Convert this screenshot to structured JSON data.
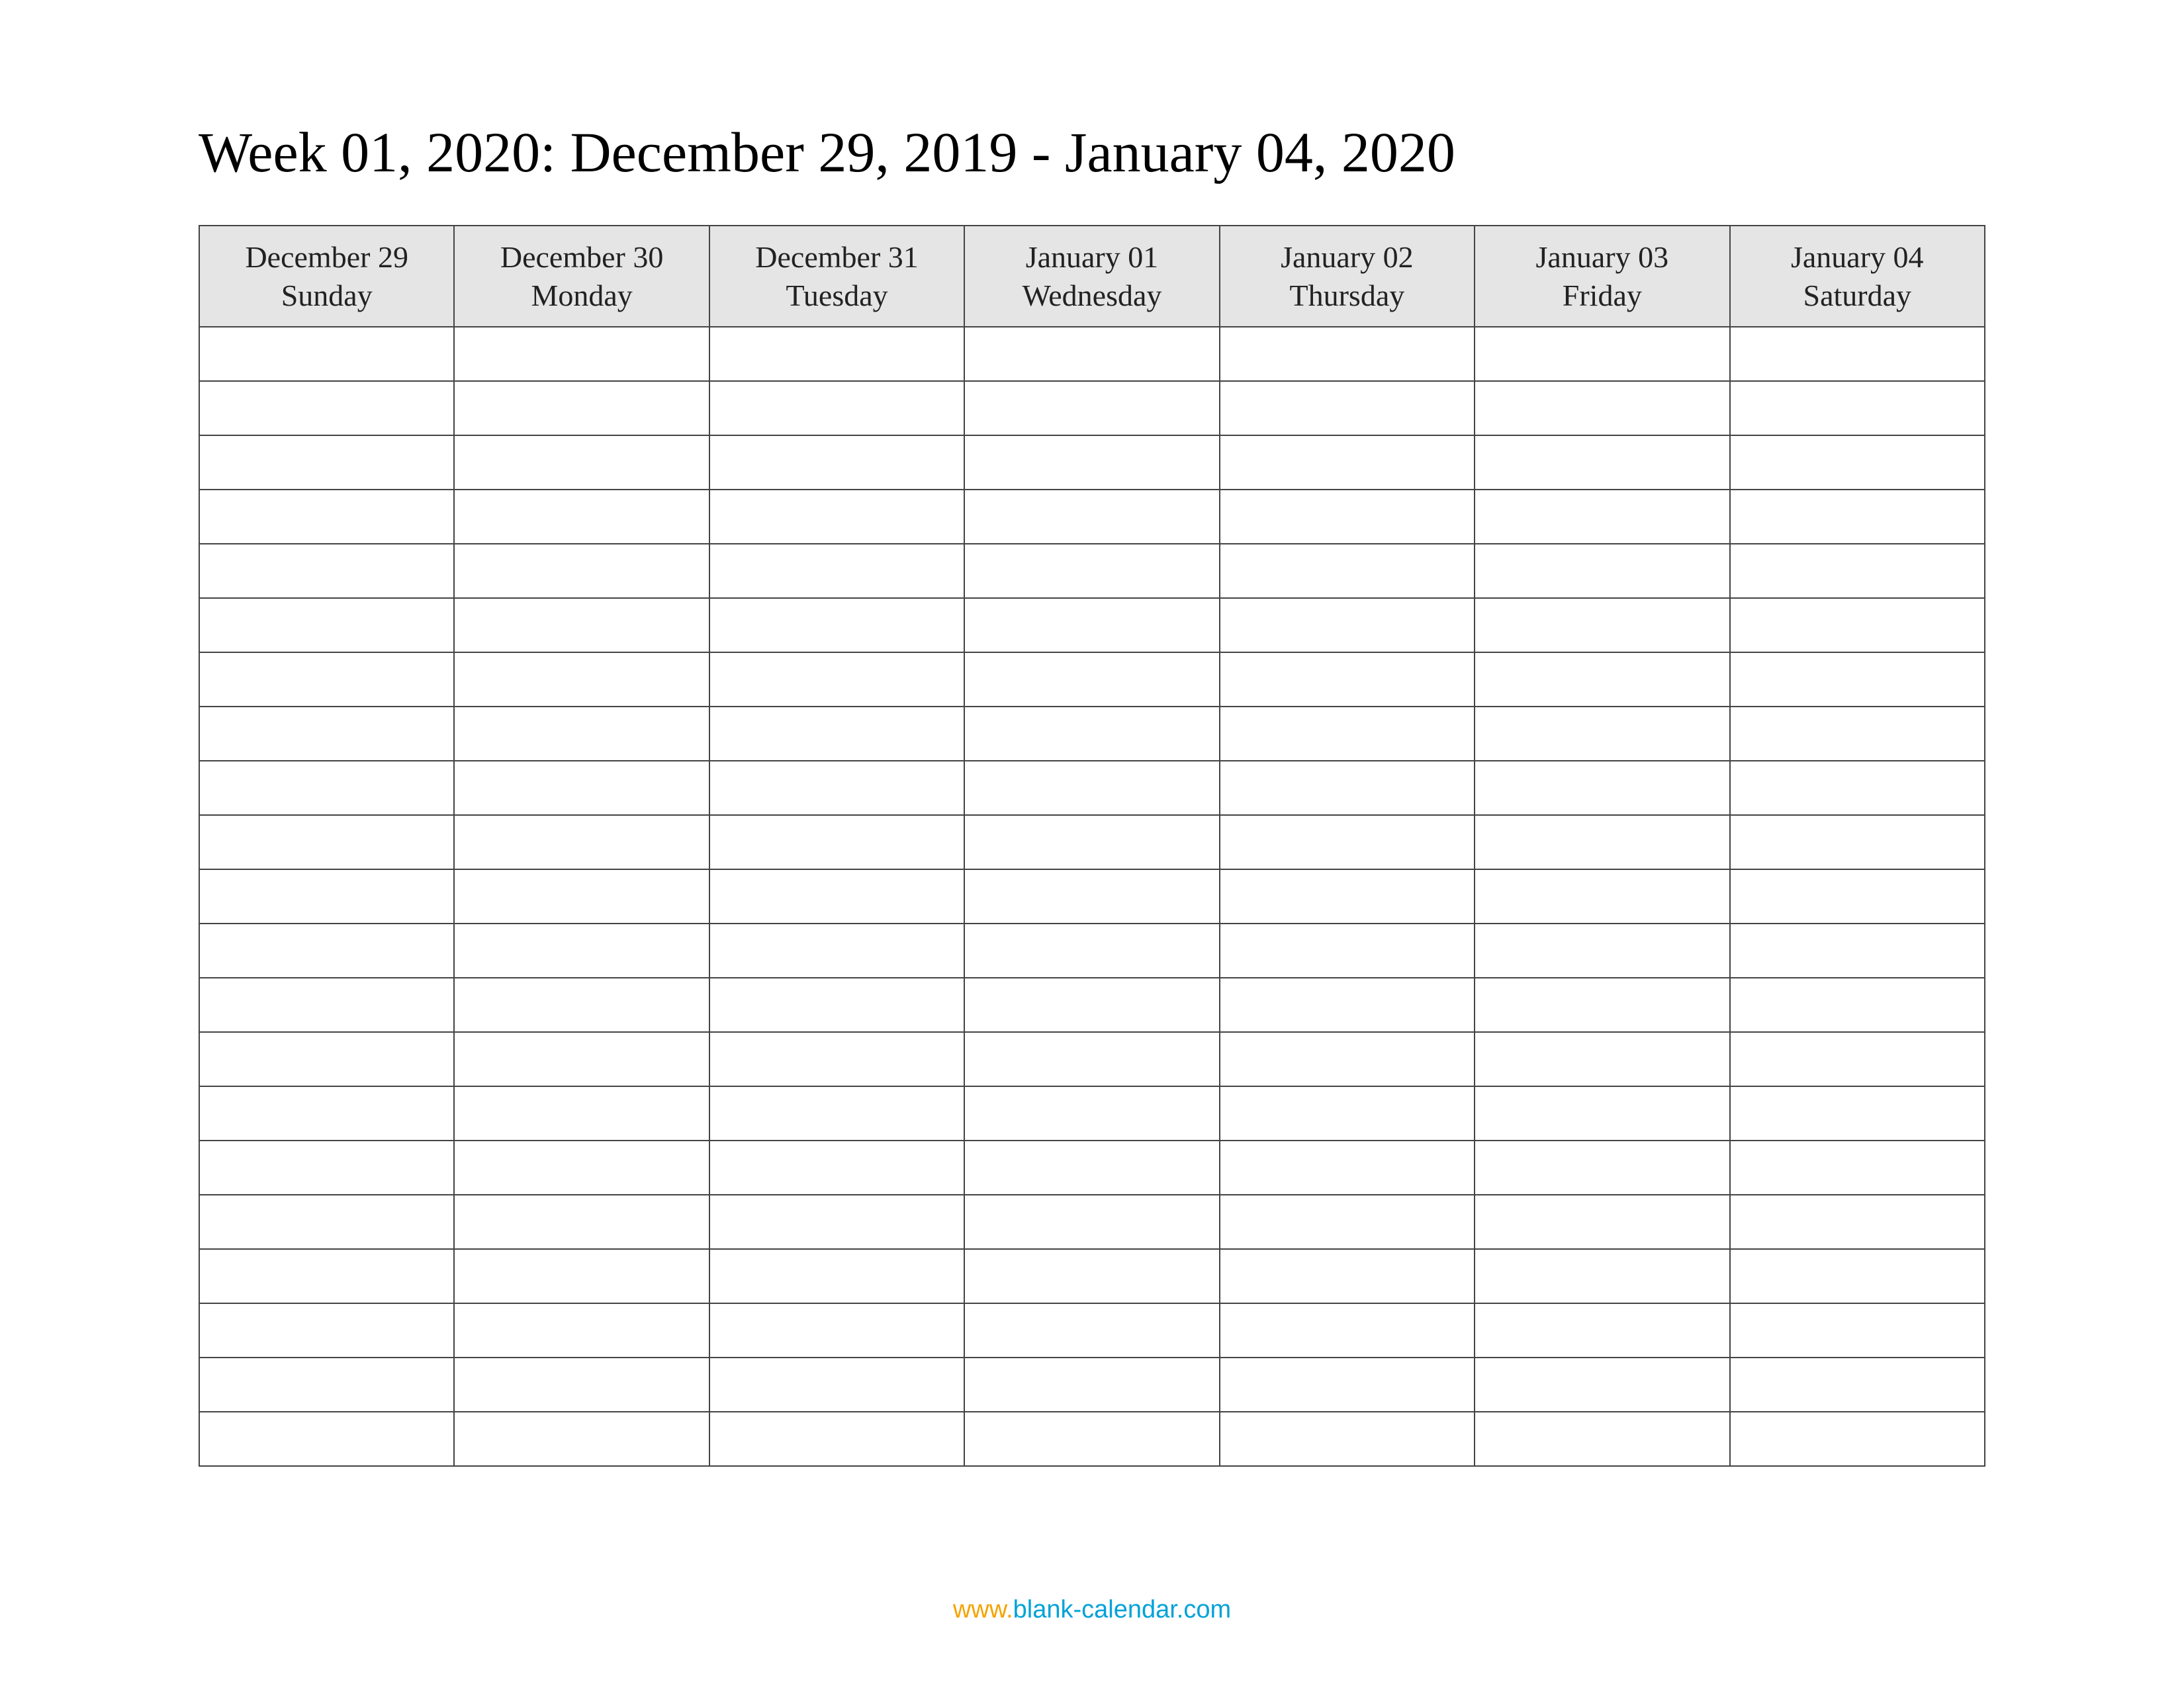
{
  "title": "Week 01, 2020: December 29, 2019 - January 04, 2020",
  "columns": [
    {
      "date": "December 29",
      "day": "Sunday"
    },
    {
      "date": "December 30",
      "day": "Monday"
    },
    {
      "date": "December 31",
      "day": "Tuesday"
    },
    {
      "date": "January 01",
      "day": "Wednesday"
    },
    {
      "date": "January 02",
      "day": "Thursday"
    },
    {
      "date": "January 03",
      "day": "Friday"
    },
    {
      "date": "January 04",
      "day": "Saturday"
    }
  ],
  "row_count": 21,
  "footer": {
    "www": "www.",
    "domain": "blank-calendar.com"
  }
}
